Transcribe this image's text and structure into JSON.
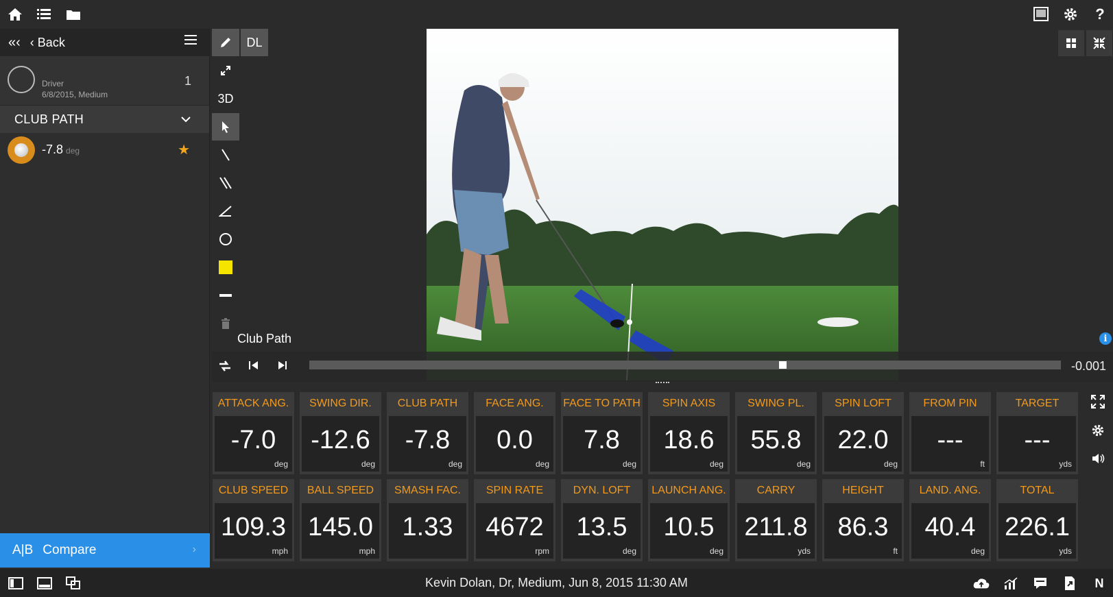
{
  "sidebar": {
    "back_label": "Back",
    "session": {
      "club": "Driver",
      "meta": "6/8/2015, Medium",
      "count": "1"
    },
    "metric_header": "CLUB PATH",
    "shots": [
      {
        "value": "-7.8",
        "unit": "deg"
      }
    ],
    "compare": {
      "ab": "A|B",
      "label": "Compare"
    }
  },
  "tools": {
    "three_d": "3D",
    "dl": "DL",
    "highlight_color": "#f5e400"
  },
  "video": {
    "overlay_label": "Club Path",
    "time": "-0.001",
    "progress": 0.63
  },
  "metrics": {
    "rows": [
      [
        {
          "label": "ATTACK ANG.",
          "value": "-7.0",
          "unit": "deg"
        },
        {
          "label": "SWING DIR.",
          "value": "-12.6",
          "unit": "deg"
        },
        {
          "label": "CLUB PATH",
          "value": "-7.8",
          "unit": "deg"
        },
        {
          "label": "FACE ANG.",
          "value": "0.0",
          "unit": "deg"
        },
        {
          "label": "FACE TO PATH",
          "value": "7.8",
          "unit": "deg"
        },
        {
          "label": "SPIN AXIS",
          "value": "18.6",
          "unit": "deg"
        },
        {
          "label": "SWING PL.",
          "value": "55.8",
          "unit": "deg"
        },
        {
          "label": "SPIN LOFT",
          "value": "22.0",
          "unit": "deg"
        },
        {
          "label": "FROM PIN",
          "value": "---",
          "unit": "ft"
        },
        {
          "label": "TARGET",
          "value": "---",
          "unit": "yds"
        }
      ],
      [
        {
          "label": "CLUB SPEED",
          "value": "109.3",
          "unit": "mph"
        },
        {
          "label": "BALL SPEED",
          "value": "145.0",
          "unit": "mph"
        },
        {
          "label": "SMASH FAC.",
          "value": "1.33",
          "unit": ""
        },
        {
          "label": "SPIN RATE",
          "value": "4672",
          "unit": "rpm"
        },
        {
          "label": "DYN. LOFT",
          "value": "13.5",
          "unit": "deg"
        },
        {
          "label": "LAUNCH ANG.",
          "value": "10.5",
          "unit": "deg"
        },
        {
          "label": "CARRY",
          "value": "211.8",
          "unit": "yds"
        },
        {
          "label": "HEIGHT",
          "value": "86.3",
          "unit": "ft"
        },
        {
          "label": "LAND. ANG.",
          "value": "40.4",
          "unit": "deg"
        },
        {
          "label": "TOTAL",
          "value": "226.1",
          "unit": "yds"
        }
      ]
    ]
  },
  "footer": {
    "session_info": "Kevin Dolan, Dr, Medium, Jun 8, 2015 11:30 AM",
    "n_label": "N"
  },
  "colors": {
    "accent_orange": "#f39a1a",
    "accent_blue": "#2a8fe6",
    "ball_ring": "#d88c1c"
  }
}
